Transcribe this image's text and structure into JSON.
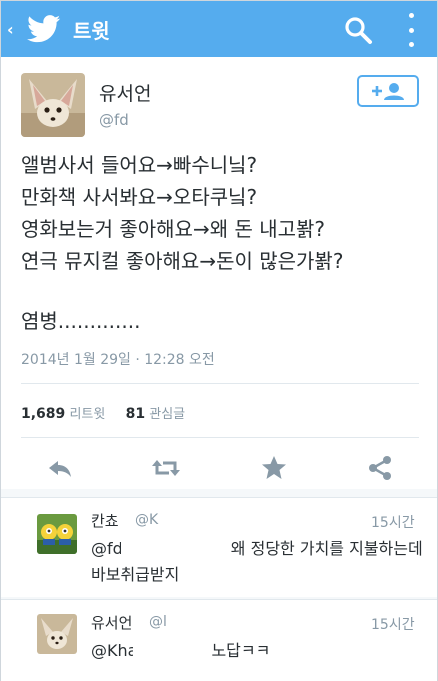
{
  "appbar": {
    "back_glyph": "‹",
    "title": "트윗",
    "icons": [
      "twitter-bird-icon",
      "search-icon",
      "overflow-menu-icon"
    ]
  },
  "tweet": {
    "author_name": "유서언",
    "author_handle": "@fd",
    "lines": [
      "앨범사서 들어요→빠수니닠?",
      "만화책 사서봐요→오타쿠닠?",
      "영화보는거 좋아해요→왜 돈 내고봙?",
      "연극 뮤지컬 좋아해요→돈이 많은가봙?"
    ],
    "closing_line": "염병.............",
    "timestamp": "2014년 1월 29일 · 12:28 오전",
    "retweets_count": "1,689",
    "retweets_label": "리트윗",
    "favorites_count": "81",
    "favorites_label": "관심글"
  },
  "replies": [
    {
      "name": "칸쵸",
      "handle": "@K",
      "time": "15시간",
      "line1_prefix": "@fd",
      "line1_rest": "왜 정당한 가치를 지불하는데",
      "line2": "바보취급받지"
    },
    {
      "name": "유서언",
      "handle": "@l",
      "time": "15시간",
      "line1_prefix": "@Kha",
      "line1_rest": "노답ㅋㅋ"
    }
  ],
  "colors": {
    "brand": "#55acee",
    "text": "#292f33",
    "muted": "#8899a6",
    "icon": "#8899a6"
  }
}
